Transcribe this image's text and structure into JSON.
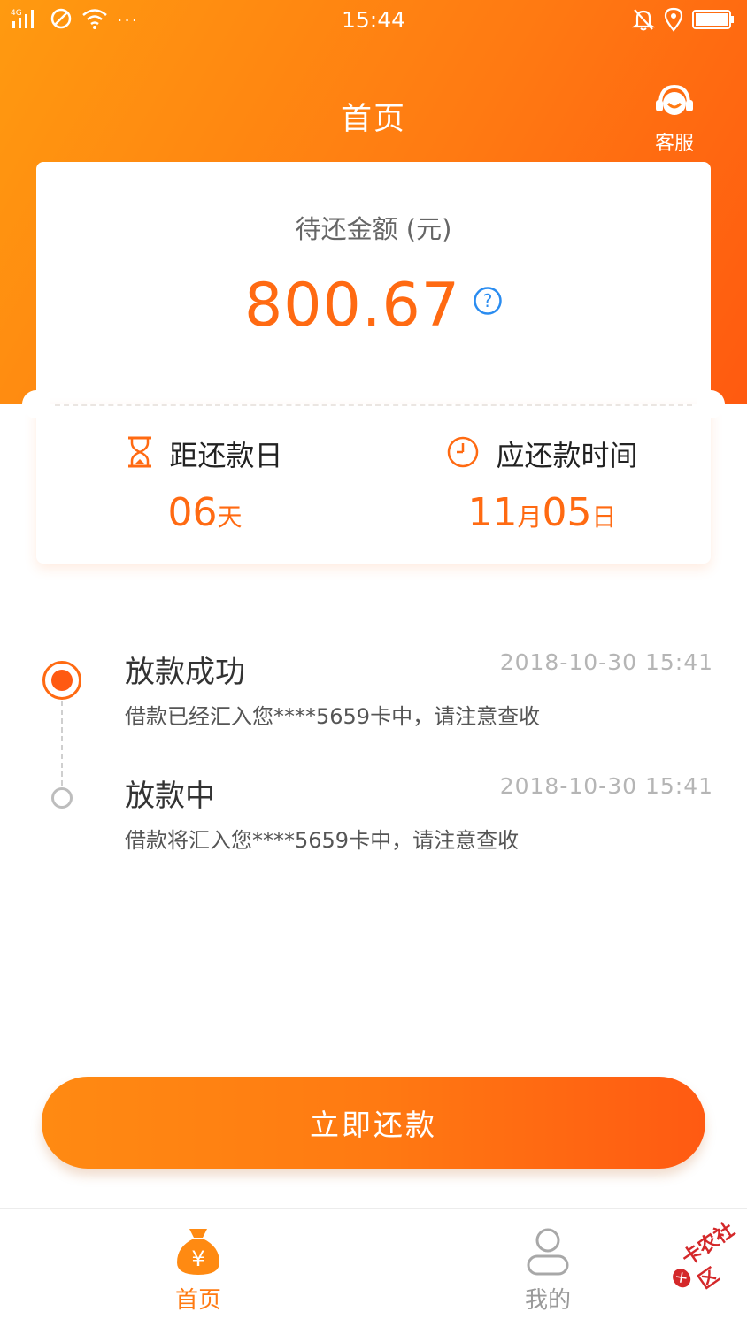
{
  "status_bar": {
    "network": "4G",
    "time": "15:44",
    "more": "···"
  },
  "header": {
    "title": "首页",
    "service_label": "客服"
  },
  "summary": {
    "amount_label": "待还金额 (元)",
    "amount": "800.67",
    "days_left_label": "距还款日",
    "days_left_value": "06",
    "days_left_unit": "天",
    "due_label": "应还款时间",
    "due_month": "11",
    "due_month_unit": "月",
    "due_day": "05",
    "due_day_unit": "日"
  },
  "timeline": [
    {
      "title": "放款成功",
      "time": "2018-10-30 15:41",
      "desc": "借款已经汇入您****5659卡中，请注意查收",
      "active": true
    },
    {
      "title": "放款中",
      "time": "2018-10-30 15:41",
      "desc": "借款将汇入您****5659卡中，请注意查收",
      "active": false
    }
  ],
  "cta": {
    "label": "立即还款"
  },
  "tabs": [
    {
      "label": "首页",
      "icon": "money-bag-icon",
      "active": true
    },
    {
      "label": "我的",
      "icon": "user-icon",
      "active": false
    }
  ],
  "watermark": {
    "text": "卡农社区"
  },
  "colors": {
    "accent": "#ff6a12",
    "gradient_start": "#ff9a10",
    "gradient_end": "#ff5a10",
    "inactive": "#9a9a9a"
  }
}
